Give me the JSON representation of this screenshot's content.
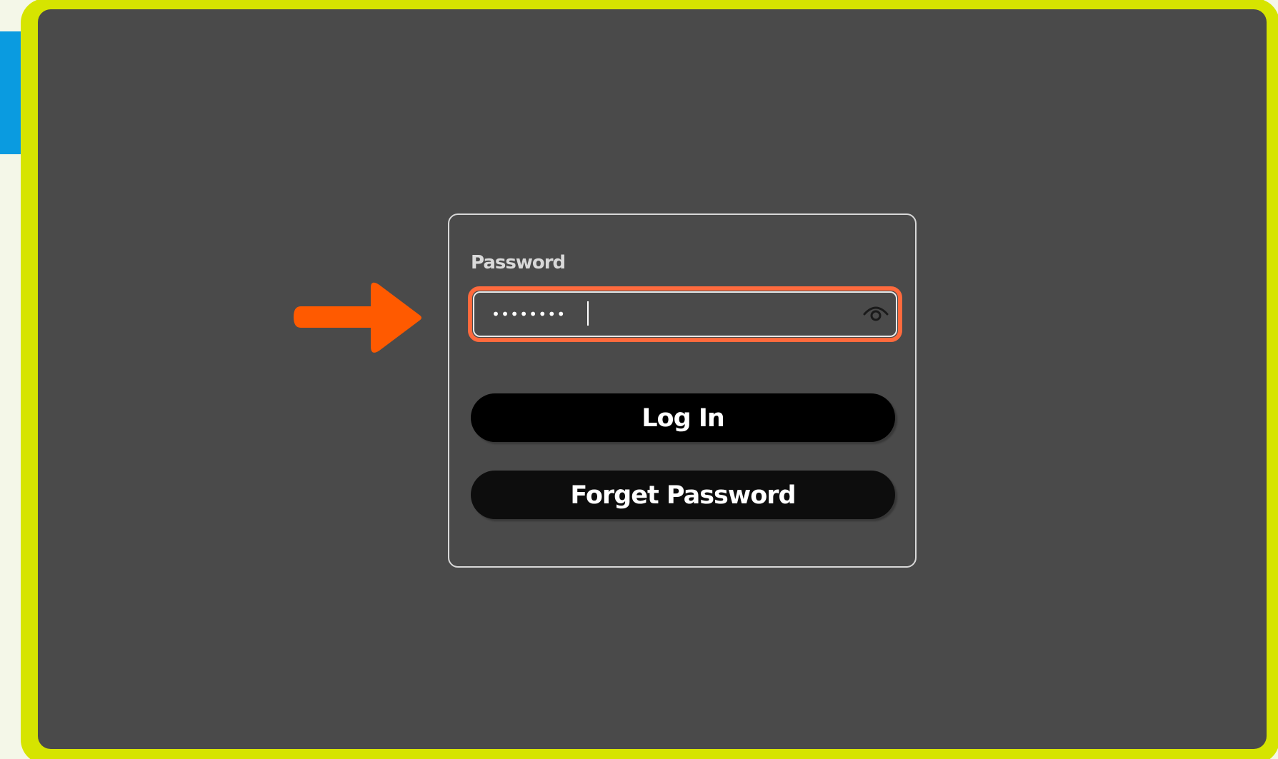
{
  "login_form": {
    "password_label": "Password",
    "password_value": "••••••••",
    "show_password_icon": "eye-icon",
    "login_label": "Log In",
    "forget_password_label": "Forget Password"
  },
  "annotation": {
    "pointer_icon": "right-arrow-icon",
    "highlight_color": "#ff6a3d",
    "arrow_color": "#ff5a00"
  },
  "colors": {
    "frame": "#d6e400",
    "screen": "#4a4a4a",
    "side_tab": "#0a9be0"
  }
}
